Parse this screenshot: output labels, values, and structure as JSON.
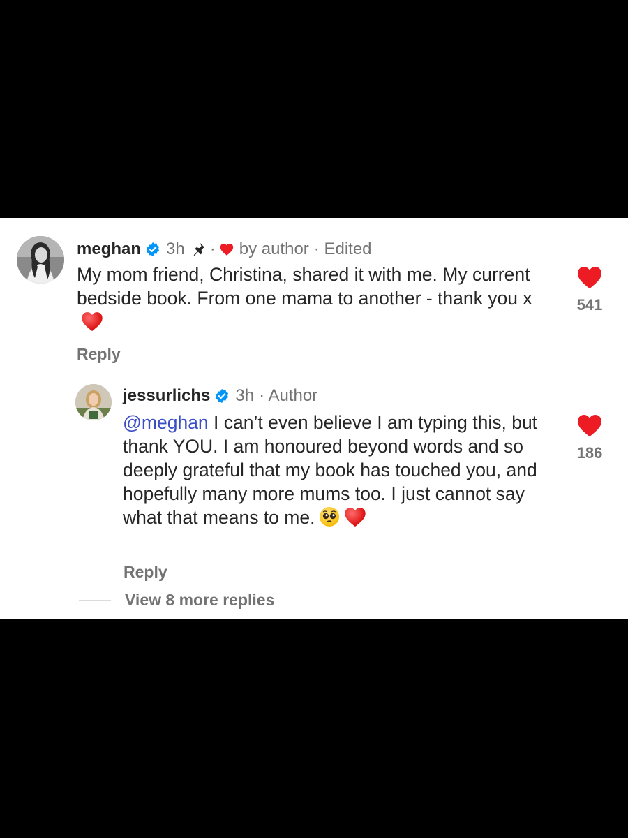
{
  "comments": [
    {
      "username": "meghan",
      "time": "3h",
      "dot": "·",
      "liked_by_author": "by author",
      "edited": "· Edited",
      "text": "My mom friend, Christina, shared it with me. My current bedside book. From one mama to another - thank you x",
      "emoji": "red-heart",
      "reply_label": "Reply",
      "likes": "541"
    },
    {
      "username": "jessurlichs",
      "time": "3h",
      "author_badge": "· Author",
      "mention": "@meghan",
      "text": " I can’t even believe I am typing this, but thank YOU. I am honoured beyond words and so deeply grateful that my book has touched you, and hopefully many more mums too. I just cannot say what that means to me.",
      "emoji": [
        "pleading-face",
        "red-heart"
      ],
      "reply_label": "Reply",
      "likes": "186"
    }
  ],
  "view_more": "View 8 more replies",
  "colors": {
    "heart": "#ed1c24",
    "verified": "#0095f6",
    "mention": "#3b4fc4",
    "muted": "#737373",
    "text": "#262626"
  }
}
